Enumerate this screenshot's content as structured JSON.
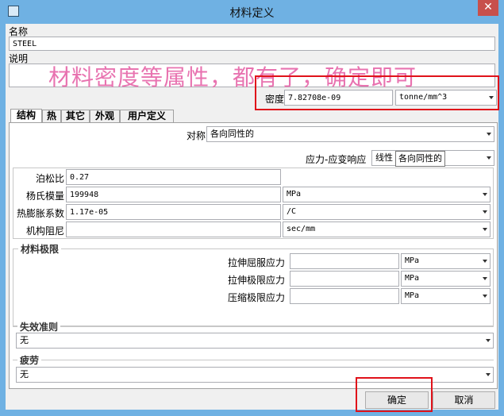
{
  "window": {
    "title": "材料定义",
    "close_glyph": "✕"
  },
  "name": {
    "label": "名称",
    "value": "STEEL"
  },
  "description": {
    "label": "说明",
    "value": ""
  },
  "overlay_text": "材料密度等属性，都有了，确定即可",
  "density": {
    "label": "密度",
    "value": "7.82708e-09",
    "unit": "tonne/mm^3"
  },
  "tabs": [
    {
      "label": "结构"
    },
    {
      "label": "热"
    },
    {
      "label": "其它"
    },
    {
      "label": "外观"
    },
    {
      "label": "用户定义"
    }
  ],
  "symmetry": {
    "label": "对称",
    "value": "各向同性的"
  },
  "stress_strain": {
    "label": "应力-应变响应",
    "value": "线性",
    "tooltip": "各向同性的"
  },
  "properties": [
    {
      "label": "泊松比",
      "value": "0.27",
      "unit": ""
    },
    {
      "label": "杨氏模量",
      "value": "199948",
      "unit": "MPa"
    },
    {
      "label": "热膨胀系数",
      "value": "1.17e-05",
      "unit": "/C"
    },
    {
      "label": "机构阻尼",
      "value": "",
      "unit": "sec/mm"
    }
  ],
  "limits": {
    "title": "材料极限",
    "rows": [
      {
        "label": "拉伸屈服应力",
        "value": "",
        "unit": "MPa"
      },
      {
        "label": "拉伸极限应力",
        "value": "",
        "unit": "MPa"
      },
      {
        "label": "压缩极限应力",
        "value": "",
        "unit": "MPa"
      }
    ]
  },
  "failure": {
    "title": "失效准则",
    "value": "无"
  },
  "fatigue": {
    "title": "疲劳",
    "value": "无"
  },
  "buttons": {
    "ok": "确定",
    "cancel": "取消"
  },
  "colors": {
    "highlight": "#e0121a",
    "overlay": "#e873b0",
    "titlebar": "#6fb1e3"
  }
}
